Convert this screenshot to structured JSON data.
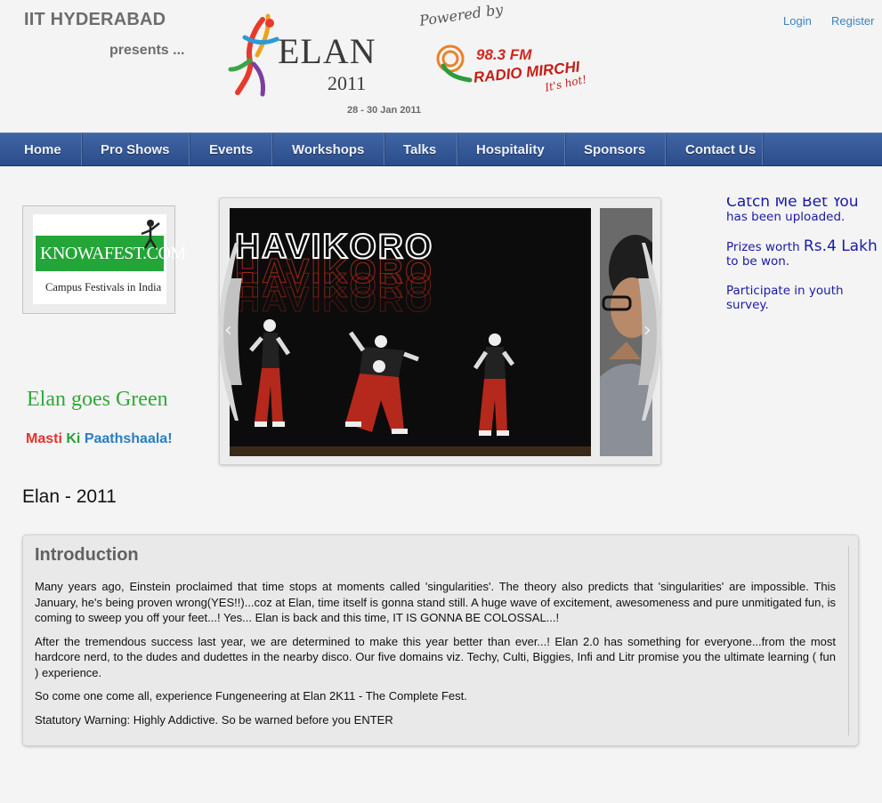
{
  "header": {
    "org": "IIT HYDERABAD",
    "presents": "presents ...",
    "logo_word": "ELAN",
    "logo_year": "2011",
    "dates": "28 - 30 Jan 2011",
    "powered_by": "Powered by",
    "sponsor_fm": "98.3 FM",
    "sponsor_name": "RADIO MIRCHI",
    "sponsor_tagline": "It's hot!",
    "login": "Login",
    "register": "Register"
  },
  "nav": {
    "items": [
      {
        "label": "Home"
      },
      {
        "label": "Pro Shows"
      },
      {
        "label": "Events"
      },
      {
        "label": "Workshops"
      },
      {
        "label": "Talks"
      },
      {
        "label": "Hospitality"
      },
      {
        "label": "Sponsors"
      },
      {
        "label": "Contact Us"
      }
    ]
  },
  "sidebar": {
    "knowafest_main": "KNOWAFEST.COM",
    "knowafest_sub": "Campus Festivals in India",
    "green": "Elan goes Green",
    "masti_1": "Masti",
    "masti_2": "Ki",
    "masti_3": "Paathshaala!"
  },
  "slider": {
    "title": "HAVIKORO"
  },
  "news": [
    {
      "text": "Catch Me Bet You",
      "extra": "has been uploaded."
    },
    {
      "pre": "Prizes worth ",
      "big": "Rs.4 Lakh",
      "post": " to be won."
    },
    {
      "text": "Participate in youth survey."
    }
  ],
  "main": {
    "heading": "Elan - 2011",
    "intro_title": "Introduction",
    "paragraphs": [
      "Many years ago, Einstein proclaimed that time stops at moments called 'singularities'. The theory also predicts that 'singularities' are impossible. This January, he's being proven wrong(YES!!)...coz at Elan, time itself is gonna stand still. A huge wave of excitement, awesomeness and pure unmitigated fun, is coming to sweep you off your feet...! Yes... Elan is back and this time, IT IS GONNA BE COLOSSAL...!",
      "After the tremendous success last year, we are determined to make this year better than ever...! Elan 2.0 has something for everyone...from the most hardcore nerd, to the dudes and dudettes in the nearby disco. Our five domains viz. Techy, Culti, Biggies, Infi and Litr promise you the ultimate learning ( fun ) experience.",
      "So come one come all, experience Fungeneering at Elan 2K11 - The Complete Fest.",
      "Statutory Warning: Highly Addictive. So be warned before you ENTER"
    ]
  },
  "colors": {
    "nav": "#34589a",
    "link": "#3a84c0",
    "news": "#1a1aa6",
    "green": "#2ea936"
  }
}
